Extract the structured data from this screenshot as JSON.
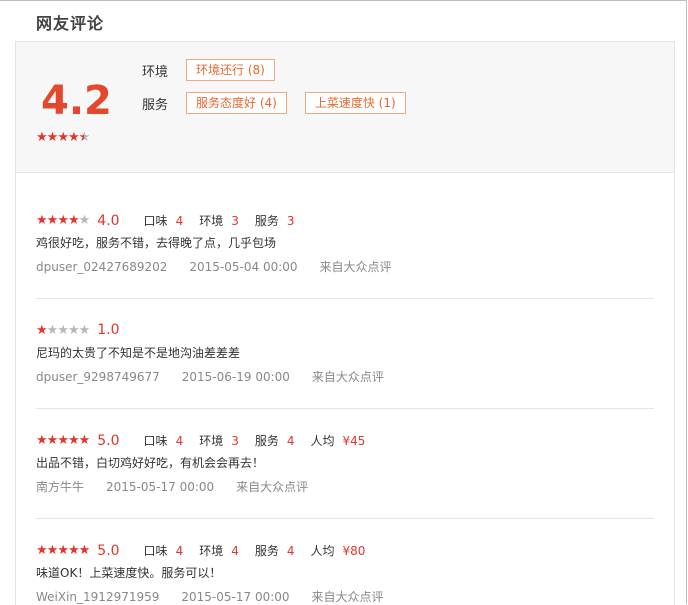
{
  "section_title": "网友评论",
  "summary": {
    "score": "4.2",
    "stars": 4.5,
    "tag_groups": [
      {
        "label": "环境",
        "tags": [
          "环境还行 (8)"
        ]
      },
      {
        "label": "服务",
        "tags": [
          "服务态度好 (4)",
          "上菜速度快 (1)"
        ]
      }
    ]
  },
  "reviews": [
    {
      "stars": 4,
      "score": "4.0",
      "subs": [
        {
          "label": "口味",
          "value": "4"
        },
        {
          "label": "环境",
          "value": "3"
        },
        {
          "label": "服务",
          "value": "3"
        }
      ],
      "text": "鸡很好吃，服务不错，去得晚了点，几乎包场",
      "user": "dpuser_02427689202",
      "date": "2015-05-04 00:00",
      "source": "来自大众点评"
    },
    {
      "stars": 1,
      "score": "1.0",
      "subs": [],
      "text": "尼玛的太贵了不知是不是地沟油差差差",
      "user": "dpuser_9298749677",
      "date": "2015-06-19 00:00",
      "source": "来自大众点评"
    },
    {
      "stars": 5,
      "score": "5.0",
      "subs": [
        {
          "label": "口味",
          "value": "4"
        },
        {
          "label": "环境",
          "value": "3"
        },
        {
          "label": "服务",
          "value": "4"
        },
        {
          "label": "人均",
          "value": "¥45"
        }
      ],
      "text": "出品不错，白切鸡好好吃，有机会会再去！",
      "user": "南方牛牛",
      "date": "2015-05-17 00:00",
      "source": "来自大众点评"
    },
    {
      "stars": 5,
      "score": "5.0",
      "subs": [
        {
          "label": "口味",
          "value": "4"
        },
        {
          "label": "环境",
          "value": "4"
        },
        {
          "label": "服务",
          "value": "4"
        },
        {
          "label": "人均",
          "value": "¥80"
        }
      ],
      "text": "味道OK！上菜速度快。服务可以！",
      "user": "WeiXin_1912971959",
      "date": "2015-05-17 00:00",
      "source": "来自大众点评"
    }
  ],
  "colors": {
    "accent": "#e4342c",
    "tag_border": "#f2a783",
    "tag_text": "#e56a30",
    "summary_bg": "#f7f7f7"
  }
}
